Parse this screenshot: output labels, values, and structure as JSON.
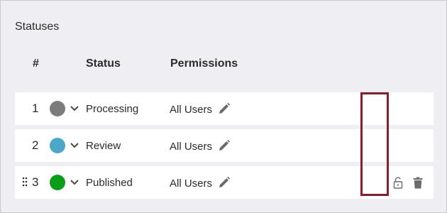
{
  "section": {
    "title": "Statuses"
  },
  "columns": {
    "number": "#",
    "status": "Status",
    "permissions": "Permissions"
  },
  "rows": [
    {
      "number": "1",
      "status": "Processing",
      "color": "#7c7c7c",
      "permissions": "All Users"
    },
    {
      "number": "2",
      "status": "Review",
      "color": "#4ba7c8",
      "permissions": "All Users"
    },
    {
      "number": "3",
      "status": "Published",
      "color": "#0a9e18",
      "permissions": "All Users"
    }
  ],
  "icons": {
    "drag": "drag-handle-icon",
    "chevron": "chevron-down-icon",
    "edit": "pencil-icon",
    "lock": "lock-icon",
    "delete": "trash-icon"
  },
  "colors": {
    "highlight": "#8b1e2b",
    "icon": "#6b6b6b"
  }
}
